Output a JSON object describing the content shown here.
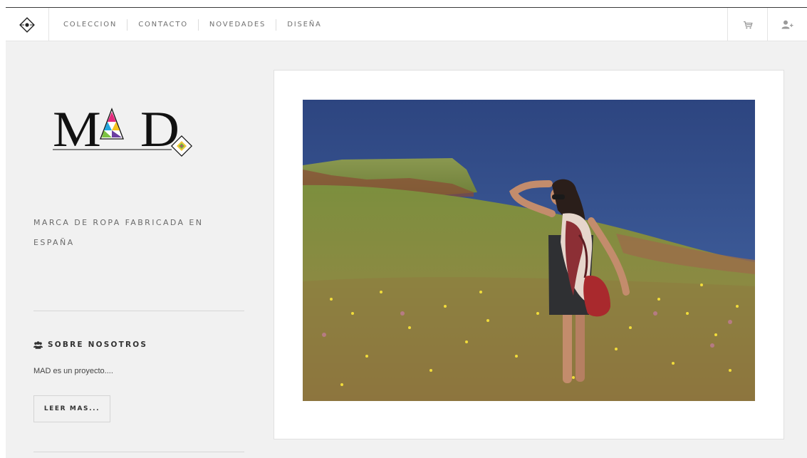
{
  "header": {
    "nav": [
      {
        "label": "COLECCION"
      },
      {
        "label": "CONTACTO"
      },
      {
        "label": "NOVEDADES"
      },
      {
        "label": "DISEÑA"
      }
    ],
    "icons": [
      "diamond-logo-icon",
      "cart-icon",
      "add-user-icon"
    ]
  },
  "sidebar": {
    "brand": "MAD",
    "tagline": "MARCA DE ROPA FABRICADA EN ESPAÑA",
    "about": {
      "title": "SOBRE NOSOTROS",
      "icon": "users-icon",
      "text": "MAD es un proyecto....",
      "button": "LEER MAS..."
    }
  },
  "colors": {
    "background": "#f1f1f1",
    "card": "#ffffff",
    "nav_text": "#6f6f6f",
    "heading": "#333333"
  }
}
